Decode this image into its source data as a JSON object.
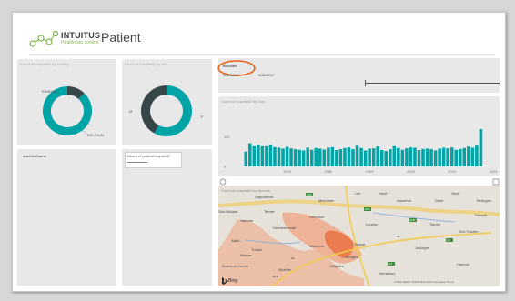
{
  "header": {
    "brand": "INTUITUS",
    "subtitle": "Healthcare context",
    "title": "Patient"
  },
  "donut_country": {
    "title": "Count of hospitalID by country",
    "labels": [
      "FRANCE",
      "BELGIUM"
    ]
  },
  "donut_sex": {
    "title": "Count of hospitalID by sex",
    "labels": [
      "M",
      "F"
    ]
  },
  "machine": {
    "label": "machineName"
  },
  "patient_card": {
    "title": "Count of patientHospitalID"
  },
  "birthdate": {
    "label": "birthdate",
    "from": "1/30/1960",
    "to": "9/21/2017"
  },
  "year_chart": {
    "title": "Count of hospitalID by Year"
  },
  "map": {
    "title": "Count of hospitalID by zipcode",
    "bing_label": "Bing",
    "copyright": "©2018 HERE ©2018 Microsoft Corporation Terms",
    "place_names": [
      "Zwijndrecht",
      "Sint-Niklaas",
      "Temse",
      "Hamme",
      "Dendermonde",
      "Aalst",
      "Ninove",
      "Mechelen",
      "Vilvoorde",
      "Leuven",
      "Tienen",
      "Sint-Truiden",
      "Aarschot",
      "Diest",
      "Braine-le-Comte",
      "Nivelles",
      "Waterloo",
      "Wavre",
      "Jodoigne",
      "Bierges",
      "Tubize",
      "Ottignies",
      "Gembloux",
      "Lier",
      "Heist",
      "Geel",
      "Beringen",
      "Hasselt",
      "Hannut"
    ],
    "road_labels": [
      "A14",
      "A12",
      "E40",
      "A1",
      "A2",
      "A3",
      "A4",
      "E19"
    ]
  },
  "chart_data": [
    {
      "type": "pie",
      "title": "Count of hospitalID by country",
      "categories": [
        "BELGIUM",
        "FRANCE"
      ],
      "values": [
        88,
        12
      ],
      "colors": [
        "#00a3a6",
        "#374649"
      ]
    },
    {
      "type": "pie",
      "title": "Count of hospitalID by sex",
      "categories": [
        "F",
        "M"
      ],
      "values": [
        58,
        42
      ],
      "colors": [
        "#00a3a6",
        "#374649"
      ]
    },
    {
      "type": "bar",
      "title": "Count of hospitalID by Year",
      "xlabel": "",
      "ylabel": "",
      "xticks": [
        1970,
        1980,
        1990,
        2000,
        2010,
        2020
      ],
      "yticks": [
        0,
        100
      ],
      "ylim": [
        0,
        175
      ],
      "x": [
        1960,
        1961,
        1962,
        1963,
        1964,
        1965,
        1966,
        1967,
        1968,
        1969,
        1970,
        1971,
        1972,
        1973,
        1974,
        1975,
        1976,
        1977,
        1978,
        1979,
        1980,
        1981,
        1982,
        1983,
        1984,
        1985,
        1986,
        1987,
        1988,
        1989,
        1990,
        1991,
        1992,
        1993,
        1994,
        1995,
        1996,
        1997,
        1998,
        1999,
        2000,
        2001,
        2002,
        2003,
        2004,
        2005,
        2006,
        2007,
        2008,
        2009,
        2010,
        2011,
        2012,
        2013,
        2014,
        2015,
        2016,
        2017
      ],
      "values": [
        50,
        78,
        68,
        72,
        68,
        68,
        72,
        65,
        63,
        60,
        66,
        61,
        58,
        56,
        54,
        63,
        56,
        62,
        60,
        57,
        63,
        65,
        55,
        58,
        62,
        64,
        58,
        70,
        62,
        54,
        60,
        61,
        67,
        55,
        52,
        58,
        68,
        62,
        56,
        61,
        64,
        63,
        55,
        59,
        60,
        58,
        54,
        60,
        63,
        61,
        64,
        56,
        59,
        62,
        67,
        63,
        70,
        126
      ],
      "color": "#00a3a6"
    }
  ]
}
